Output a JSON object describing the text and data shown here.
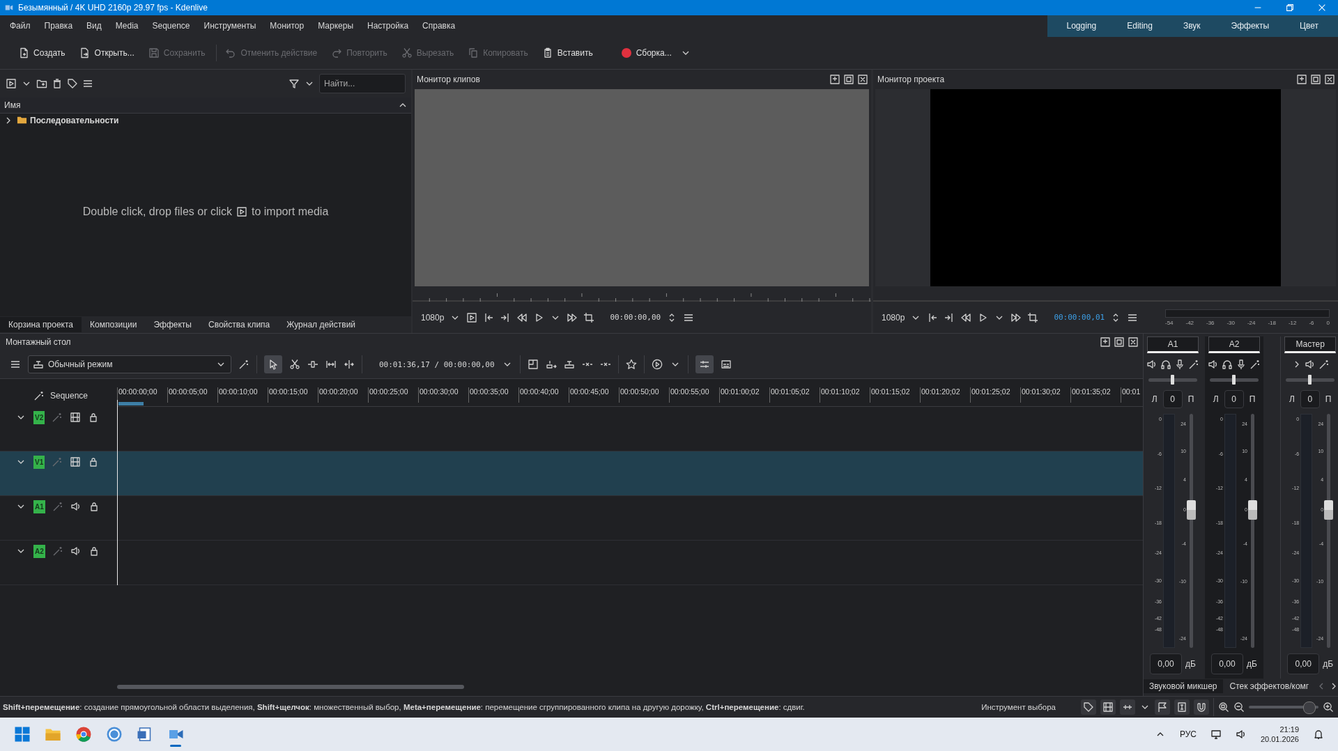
{
  "window": {
    "title": "Безымянный / 4K UHD 2160p 29.97 fps - Kdenlive"
  },
  "menu": [
    "Файл",
    "Правка",
    "Вид",
    "Media",
    "Sequence",
    "Инструменты",
    "Монитор",
    "Маркеры",
    "Настройка",
    "Справка"
  ],
  "workspaces": [
    "Logging",
    "Editing",
    "Звук",
    "Эффекты",
    "Цвет"
  ],
  "toolbar": [
    {
      "label": "Создать",
      "disabled": false
    },
    {
      "label": "Открыть...",
      "disabled": false
    },
    {
      "label": "Сохранить",
      "disabled": true
    },
    {
      "label": "Отменить действие",
      "disabled": true
    },
    {
      "label": "Повторить",
      "disabled": true
    },
    {
      "label": "Вырезать",
      "disabled": true
    },
    {
      "label": "Копировать",
      "disabled": true
    },
    {
      "label": "Вставить",
      "disabled": false
    }
  ],
  "render": {
    "label": "Сборка..."
  },
  "project_bin": {
    "search": {
      "placeholder": "Найти..."
    },
    "column": "Имя",
    "tree": [
      {
        "label": "Последовательности",
        "expanded": false
      }
    ],
    "empty_hint": {
      "before": "Double click, drop files or click",
      "after": "to import media"
    },
    "tabs": [
      {
        "label": "Корзина проекта",
        "selected": true
      },
      {
        "label": "Композиции",
        "selected": false
      },
      {
        "label": "Эффекты",
        "selected": false
      },
      {
        "label": "Свойства клипа",
        "selected": false
      },
      {
        "label": "Журнал действий",
        "selected": false
      }
    ]
  },
  "clip_monitor": {
    "title": "Монитор клипов",
    "resolution": "1080p",
    "timecode": "00:00:00,00"
  },
  "project_monitor": {
    "title": "Монитор проекта",
    "resolution": "1080p",
    "timecode": "00:00:00,01",
    "meter_scale": [
      "-54",
      "-42",
      "-36",
      "-30",
      "-24",
      "-18",
      "-12",
      "-6",
      "0"
    ]
  },
  "timeline": {
    "title": "Монтажный стол",
    "mode": "Обычный режим",
    "timecode": "00:01:36,17 / 00:00:00,00",
    "sequence": "Sequence",
    "ruler": [
      "00:00:00;00",
      "00:00:05;00",
      "00:00:10;00",
      "00:00:15;00",
      "00:00:20;00",
      "00:00:25;00",
      "00:00:30;00",
      "00:00:35;00",
      "00:00:40;00",
      "00:00:45;00",
      "00:00:50;00",
      "00:00:55;00",
      "00:01:00;02",
      "00:01:05;02",
      "00:01:10;02",
      "00:01:15;02",
      "00:01:20;02",
      "00:01:25;02",
      "00:01:30;02",
      "00:01:35;02",
      "00:01"
    ],
    "tracks": [
      {
        "tag": "V2",
        "kind": "video",
        "selected": false
      },
      {
        "tag": "V1",
        "kind": "video",
        "selected": true
      },
      {
        "tag": "A1",
        "kind": "audio",
        "selected": false
      },
      {
        "tag": "A2",
        "kind": "audio",
        "selected": false
      }
    ]
  },
  "mixer": {
    "strips": [
      {
        "name": "A1",
        "kind": "track",
        "pan": {
          "level": 0.5
        },
        "left": "Л",
        "balance": "0",
        "right": "П",
        "meter_scale": [
          "0",
          "-6",
          "-12",
          "-18",
          "-24",
          "-30",
          "-36",
          "-42",
          "-48"
        ],
        "fader_scale": [
          "24",
          "10",
          "4",
          "0",
          "-4",
          "-10",
          "-24"
        ],
        "fader": {
          "level": 0.59
        },
        "gain": "0,00",
        "unit": "дБ"
      },
      {
        "name": "A2",
        "kind": "track",
        "pan": {
          "level": 0.5
        },
        "left": "Л",
        "balance": "0",
        "right": "П",
        "meter_scale": [
          "0",
          "-6",
          "-12",
          "-18",
          "-24",
          "-30",
          "-36",
          "-42",
          "-48"
        ],
        "fader_scale": [
          "24",
          "10",
          "4",
          "0",
          "-4",
          "-10",
          "-24"
        ],
        "fader": {
          "level": 0.59
        },
        "gain": "0,00",
        "unit": "дБ"
      },
      {
        "name": "Мастер",
        "kind": "master",
        "pan": {
          "level": 0.5
        },
        "left": "Л",
        "balance": "0",
        "right": "П",
        "meter_scale": [
          "0",
          "-6",
          "-12",
          "-18",
          "-24",
          "-30",
          "-36",
          "-42",
          "-48"
        ],
        "fader_scale": [
          "24",
          "10",
          "4",
          "0",
          "-4",
          "-10",
          "-24"
        ],
        "fader": {
          "level": 0.59
        },
        "gain": "0,00",
        "unit": "дБ"
      }
    ],
    "tabs": [
      {
        "label": "Звуковой микшер",
        "selected": true
      },
      {
        "label": "Стек эффектов/комг",
        "selected": false
      }
    ]
  },
  "status_bar": {
    "hint": "**Shift+перемещение**: создание прямоугольной области выделения, **Shift+щелчок**: множественный выбор, **Meta+перемещение**: перемещение сгруппированного клипа на другую дорожку, **Ctrl+перемещение**: сдвиг.",
    "tool": "Инструмент выбора"
  },
  "taskbar": {
    "language": "РУС",
    "time": "21:19",
    "date": "20.01.2026"
  }
}
